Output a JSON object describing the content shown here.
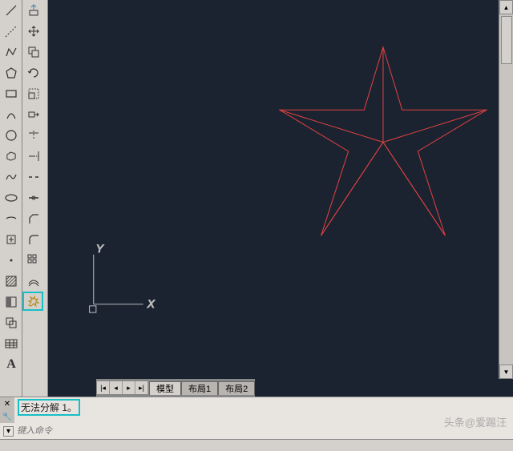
{
  "toolbar1": {
    "tools": [
      "line",
      "polyline",
      "polygon",
      "rectangle",
      "arc",
      "circle",
      "spline",
      "ellipse",
      "ellipse-arc",
      "point",
      "hatch",
      "region",
      "table",
      "text"
    ]
  },
  "toolbar2": {
    "tools": [
      "construction-line",
      "move",
      "copy",
      "stretch",
      "rotate",
      "scale",
      "mirror",
      "fillet",
      "chamfer",
      "array",
      "trim",
      "extend",
      "break",
      "join",
      "explode"
    ]
  },
  "canvas": {
    "ucs_x": "X",
    "ucs_y": "Y"
  },
  "tabs": {
    "model": "模型",
    "layout1": "布局1",
    "layout2": "布局2"
  },
  "command": {
    "output": "无法分解 1。",
    "prompt": "键入命令",
    "dropdown_icon": "⌄"
  },
  "watermark": "头条@爱踢汪",
  "text_label": "A"
}
